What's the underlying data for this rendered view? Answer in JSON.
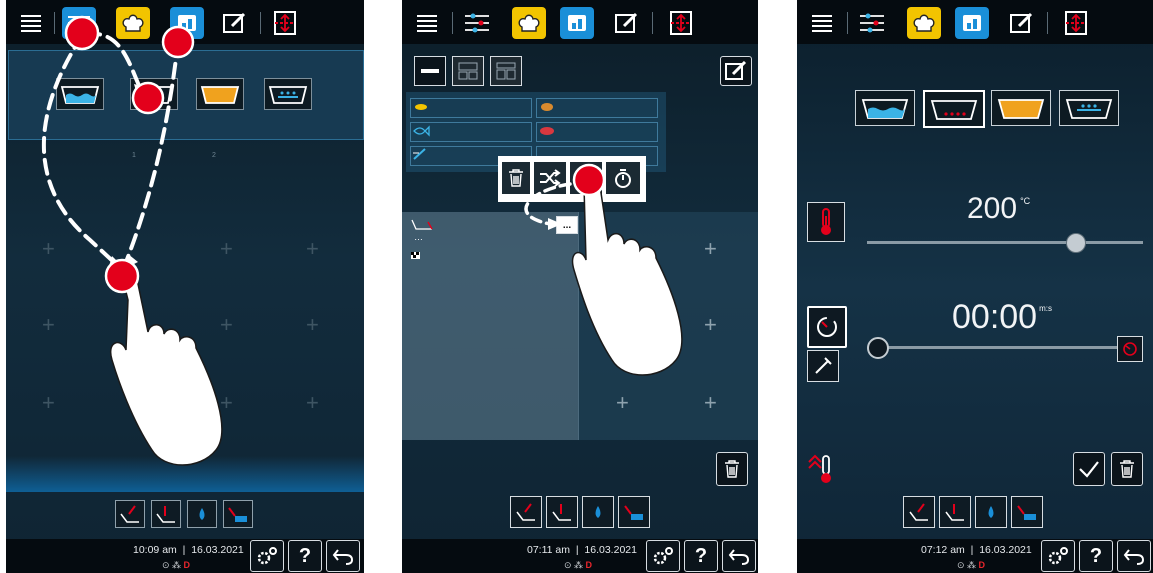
{
  "panels": [
    {
      "clock": "10:09 am",
      "date": "16.03.2021"
    },
    {
      "clock": "07:11 am",
      "date": "16.03.2021"
    },
    {
      "clock": "07:12 am",
      "date": "16.03.2021"
    }
  ],
  "grid_labels": [
    "1",
    "2"
  ],
  "timer_cell_label": "...",
  "temperature": {
    "value": "200",
    "unit": "°C",
    "level": 0.9
  },
  "time": {
    "value": "00:00",
    "unit": "m:s",
    "level": 0.0
  },
  "bottom_buttons": {
    "help": "?"
  },
  "colors": {
    "accent": "#1a8fd8",
    "marker": "#e3001b",
    "yellow": "#f2c400"
  },
  "icons": [
    "menu-icon",
    "filter-icon",
    "chef-hat-icon",
    "pan-icon",
    "edit-icon",
    "scroll-icon",
    "tray-icon",
    "trash-icon",
    "shuffle-icon",
    "timer-icon",
    "thermometer-icon",
    "tool-icon",
    "check-icon",
    "settings-icon",
    "help-icon",
    "back-icon",
    "fish-icon",
    "meat-icon",
    "chicken-icon",
    "egg-icon",
    "hand-icon"
  ]
}
